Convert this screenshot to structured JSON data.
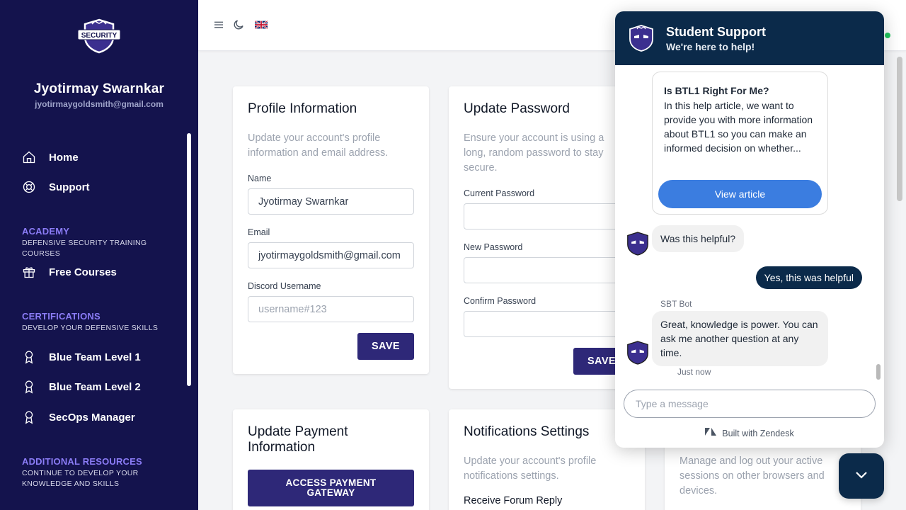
{
  "sidebar": {
    "user_name": "Jyotirmay Swarnkar",
    "user_email": "jyotirmaygoldsmith@gmail.com",
    "nav": {
      "home": "Home",
      "support": "Support",
      "free_courses": "Free Courses",
      "btl1": "Blue Team Level 1",
      "btl2": "Blue Team Level 2",
      "secops": "SecOps Manager"
    },
    "sections": {
      "academy_title": "ACADEMY",
      "academy_sub": "DEFENSIVE SECURITY TRAINING COURSES",
      "cert_title": "CERTIFICATIONS",
      "cert_sub": "DEVELOP YOUR DEFENSIVE SKILLS",
      "resources_title": "ADDITIONAL RESOURCES",
      "resources_sub": "CONTINUE TO DEVELOP YOUR KNOWLEDGE AND SKILLS"
    },
    "logo_text": "SECURITY"
  },
  "profile": {
    "title": "Profile Information",
    "description": "Update your account's profile information and email address.",
    "name_label": "Name",
    "name_value": "Jyotirmay Swarnkar",
    "email_label": "Email",
    "email_value": "jyotirmaygoldsmith@gmail.com",
    "discord_label": "Discord Username",
    "discord_placeholder": "username#123",
    "save_label": "SAVE"
  },
  "password": {
    "title": "Update Password",
    "description": "Ensure your account is using a long, random password to stay secure.",
    "current_label": "Current Password",
    "new_label": "New Password",
    "confirm_label": "Confirm Password",
    "save_label": "SAVE"
  },
  "payment": {
    "title": "Update Payment Information",
    "button_label": "ACCESS PAYMENT GATEWAY"
  },
  "notifications": {
    "title": "Notifications Settings",
    "description": "Update your account's profile notifications settings.",
    "forum_label": "Receive Forum Reply"
  },
  "sessions": {
    "description": "Manage and log out your active sessions on other browsers and devices."
  },
  "chat": {
    "title": "Student Support",
    "subtitle": "We're here to help!",
    "article_title": "Is BTL1 Right For Me?",
    "article_body": "In this help article, we want to provide you with more information about BTL1 so you can make an informed decision on whether...",
    "article_button": "View article",
    "bot_question": "Was this helpful?",
    "user_reply": "Yes, this was helpful",
    "sender_name": "SBT Bot",
    "bot_reply": "Great, knowledge is power. You can ask me another question at any time.",
    "timestamp": "Just now",
    "input_placeholder": "Type a message",
    "built_with": "Built with Zendesk"
  },
  "colors": {
    "sidebar_bg": "#14134d",
    "accent": "#2e2878",
    "chat_header": "#0b2a4a",
    "article_button": "#3b7de0",
    "section_title": "#8b7cf6"
  }
}
